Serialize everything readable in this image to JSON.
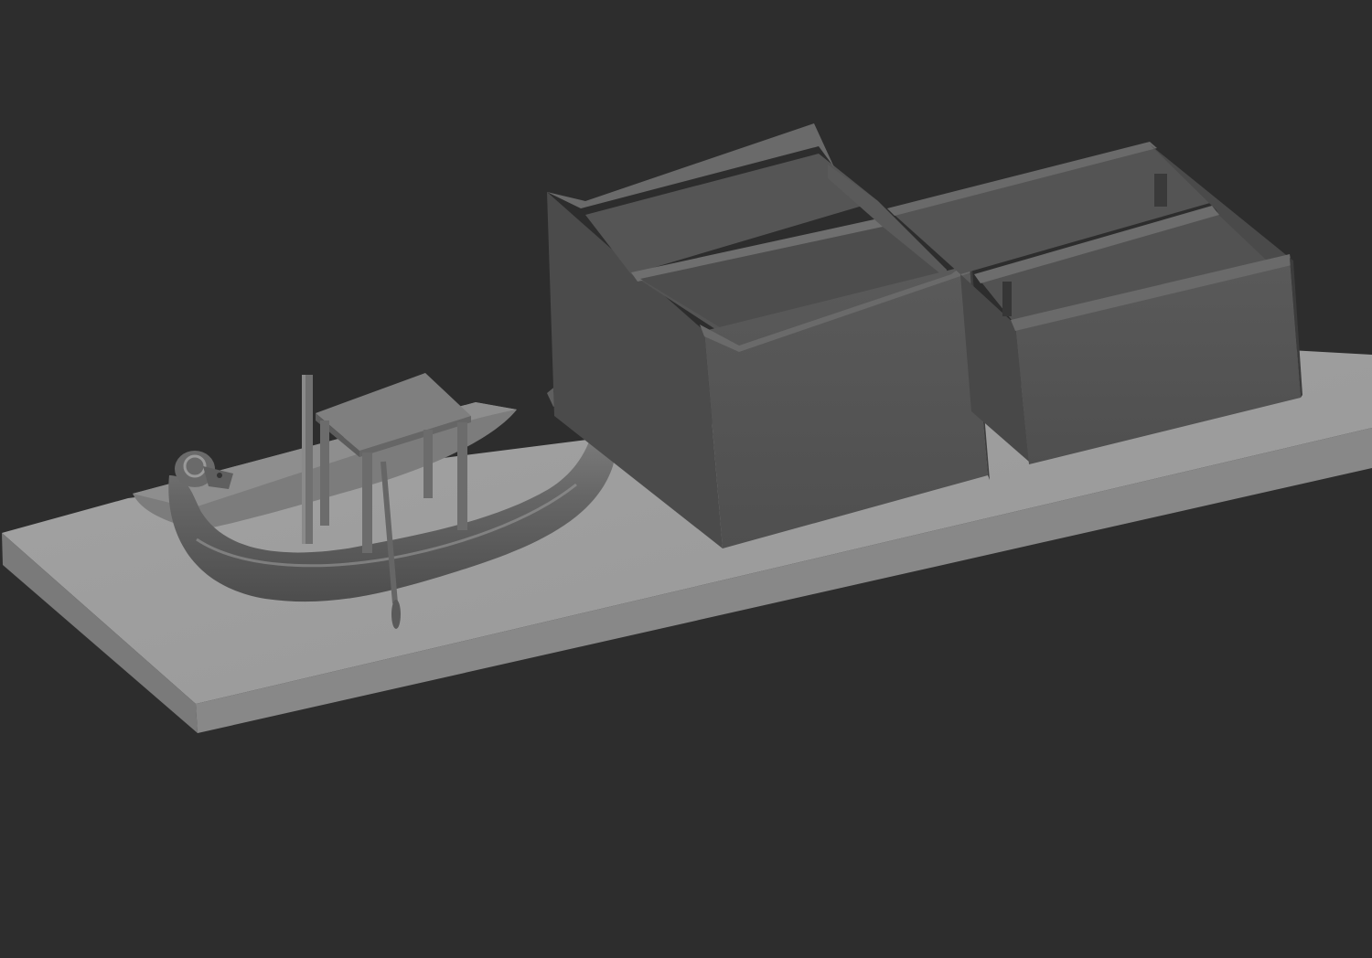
{
  "scene": {
    "background_color": "#2d2d2d",
    "objects": [
      "base-slab",
      "ram-head-boat",
      "boat-canopy",
      "mast-pole",
      "steering-oar",
      "shrine-building-left",
      "storage-building-right"
    ],
    "colors": {
      "slab_top": "#9e9e9e",
      "slab_front": "#858585",
      "wall_light": "#5e5e5e",
      "wall_mid": "#555555",
      "wall_dark": "#4a4a4a",
      "boat": "#6f6f6f"
    }
  }
}
